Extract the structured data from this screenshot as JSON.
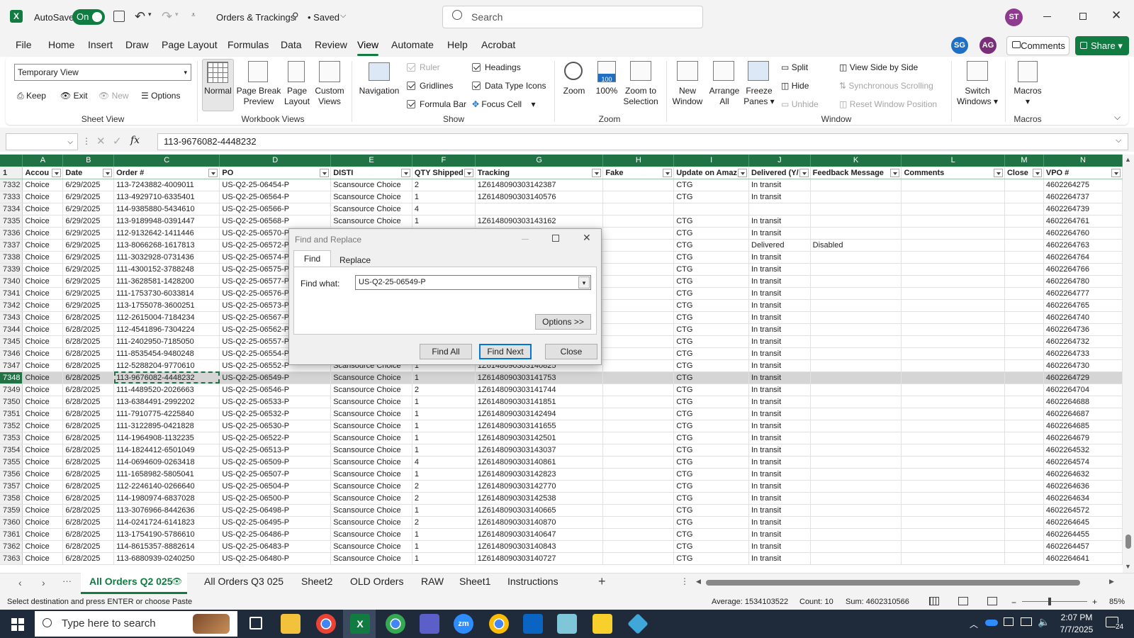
{
  "titlebar": {
    "autosave_label": "AutoSave",
    "autosave_state": "On",
    "doc_title": "Orders & Trackings",
    "saved_status": "• Saved",
    "search_placeholder": "Search",
    "user_initials": "ST"
  },
  "menu": {
    "items": [
      "File",
      "Home",
      "Insert",
      "Draw",
      "Page Layout",
      "Formulas",
      "Data",
      "Review",
      "View",
      "Automate",
      "Help",
      "Acrobat"
    ],
    "active": "View",
    "collab": [
      "SG",
      "AG"
    ],
    "comments_label": "Comments",
    "share_label": "Share"
  },
  "ribbon": {
    "sheet_view": {
      "dropdown_value": "Temporary View",
      "keep": "Keep",
      "exit": "Exit",
      "new": "New",
      "options": "Options",
      "group_label": "Sheet View"
    },
    "workbook_views": {
      "normal": "Normal",
      "page_break": "Page Break Preview",
      "page_layout": "Page Layout",
      "custom": "Custom Views",
      "group_label": "Workbook Views"
    },
    "show": {
      "navigation": "Navigation",
      "ruler": "Ruler",
      "gridlines": "Gridlines",
      "formula_bar": "Formula Bar",
      "headings": "Headings",
      "data_type_icons": "Data Type Icons",
      "focus_cell": "Focus Cell",
      "group_label": "Show"
    },
    "zoom": {
      "zoom": "Zoom",
      "hundred": "100%",
      "zoom_selection": "Zoom to Selection",
      "group_label": "Zoom"
    },
    "window": {
      "new_window": "New Window",
      "arrange_all": "Arrange All",
      "freeze_panes": "Freeze Panes",
      "split": "Split",
      "hide": "Hide",
      "unhide": "Unhide",
      "side_by_side": "View Side by Side",
      "sync_scroll": "Synchronous Scrolling",
      "reset_pos": "Reset Window Position",
      "switch": "Switch Windows",
      "group_label": "Window"
    },
    "macros": {
      "macros": "Macros",
      "group_label": "Macros"
    }
  },
  "formula_bar": {
    "name_box": "",
    "fx": "fx",
    "value": "113-9676082-4448232"
  },
  "grid": {
    "columns": [
      "A",
      "B",
      "C",
      "D",
      "E",
      "F",
      "G",
      "H",
      "I",
      "J",
      "K",
      "L",
      "M",
      "N"
    ],
    "headers": [
      "Accou",
      "Date",
      "Order #",
      "PO",
      "DISTI",
      "QTY Shipped",
      "Tracking",
      "Fake",
      "Update on Amaz",
      "Delivered (Y/",
      "Feedback Message",
      "Comments",
      "Close",
      "VPO #"
    ],
    "header_row_num": "1",
    "rows": [
      [
        "7332",
        "Choice",
        "6/29/2025",
        "113-7243882-4009011",
        "US-Q2-25-06454-P",
        "Scansource Choice",
        "2",
        "1Z6148090303142387",
        "",
        "CTG",
        "In transit",
        "",
        "",
        "",
        "4602264275"
      ],
      [
        "7333",
        "Choice",
        "6/29/2025",
        "113-4929710-6335401",
        "US-Q2-25-06564-P",
        "Scansource Choice",
        "1",
        "1Z6148090303140576",
        "",
        "CTG",
        "In transit",
        "",
        "",
        "",
        "4602264737"
      ],
      [
        "7334",
        "Choice",
        "6/29/2025",
        "114-9385880-5434610",
        "US-Q2-25-06566-P",
        "Scansource Choice",
        "4",
        "",
        "",
        "",
        "",
        "",
        "",
        "",
        "4602264739"
      ],
      [
        "7335",
        "Choice",
        "6/29/2025",
        "113-9189948-0391447",
        "US-Q2-25-06568-P",
        "Scansource Choice",
        "1",
        "1Z6148090303143162",
        "",
        "CTG",
        "In transit",
        "",
        "",
        "",
        "4602264761"
      ],
      [
        "7336",
        "Choice",
        "6/29/2025",
        "112-9132642-1411446",
        "US-Q2-25-06570-P",
        "",
        "",
        "",
        "",
        "CTG",
        "In transit",
        "",
        "",
        "",
        "4602264760"
      ],
      [
        "7337",
        "Choice",
        "6/29/2025",
        "113-8066268-1617813",
        "US-Q2-25-06572-P",
        "",
        "",
        "",
        "",
        "CTG",
        "Delivered",
        "Disabled",
        "",
        "",
        "4602264763"
      ],
      [
        "7338",
        "Choice",
        "6/29/2025",
        "111-3032928-0731436",
        "US-Q2-25-06574-P",
        "",
        "",
        "",
        "",
        "CTG",
        "In transit",
        "",
        "",
        "",
        "4602264764"
      ],
      [
        "7339",
        "Choice",
        "6/29/2025",
        "111-4300152-3788248",
        "US-Q2-25-06575-P",
        "",
        "",
        "",
        "",
        "CTG",
        "In transit",
        "",
        "",
        "",
        "4602264766"
      ],
      [
        "7340",
        "Choice",
        "6/29/2025",
        "111-3628581-1428200",
        "US-Q2-25-06577-P",
        "",
        "",
        "",
        "",
        "CTG",
        "In transit",
        "",
        "",
        "",
        "4602264780"
      ],
      [
        "7341",
        "Choice",
        "6/29/2025",
        "111-1753730-6033814",
        "US-Q2-25-06576-P",
        "",
        "",
        "",
        "",
        "CTG",
        "In transit",
        "",
        "",
        "",
        "4602264777"
      ],
      [
        "7342",
        "Choice",
        "6/29/2025",
        "113-1755078-3600251",
        "US-Q2-25-06573-P",
        "",
        "",
        "",
        "",
        "CTG",
        "In transit",
        "",
        "",
        "",
        "4602264765"
      ],
      [
        "7343",
        "Choice",
        "6/28/2025",
        "112-2615004-7184234",
        "US-Q2-25-06567-P",
        "",
        "",
        "",
        "",
        "CTG",
        "In transit",
        "",
        "",
        "",
        "4602264740"
      ],
      [
        "7344",
        "Choice",
        "6/28/2025",
        "112-4541896-7304224",
        "US-Q2-25-06562-P",
        "",
        "",
        "",
        "",
        "CTG",
        "In transit",
        "",
        "",
        "",
        "4602264736"
      ],
      [
        "7345",
        "Choice",
        "6/28/2025",
        "111-2402950-7185050",
        "US-Q2-25-06557-P",
        "",
        "",
        "",
        "",
        "CTG",
        "In transit",
        "",
        "",
        "",
        "4602264732"
      ],
      [
        "7346",
        "Choice",
        "6/28/2025",
        "111-8535454-9480248",
        "US-Q2-25-06554-P",
        "",
        "",
        "",
        "",
        "CTG",
        "In transit",
        "",
        "",
        "",
        "4602264733"
      ],
      [
        "7347",
        "Choice",
        "6/28/2025",
        "112-5288204-9770610",
        "US-Q2-25-06552-P",
        "Scansource Choice",
        "1",
        "1Z6148090303140825",
        "",
        "CTG",
        "In transit",
        "",
        "",
        "",
        "4602264730"
      ],
      [
        "7348",
        "Choice",
        "6/28/2025",
        "113-9676082-4448232",
        "US-Q2-25-06549-P",
        "Scansource Choice",
        "1",
        "1Z6148090303141753",
        "",
        "CTG",
        "In transit",
        "",
        "",
        "",
        "4602264729"
      ],
      [
        "7349",
        "Choice",
        "6/28/2025",
        "111-4489520-2026663",
        "US-Q2-25-06546-P",
        "Scansource Choice",
        "2",
        "1Z6148090303141744",
        "",
        "CTG",
        "In transit",
        "",
        "",
        "",
        "4602264704"
      ],
      [
        "7350",
        "Choice",
        "6/28/2025",
        "113-6384491-2992202",
        "US-Q2-25-06533-P",
        "Scansource Choice",
        "1",
        "1Z6148090303141851",
        "",
        "CTG",
        "In transit",
        "",
        "",
        "",
        "4602264688"
      ],
      [
        "7351",
        "Choice",
        "6/28/2025",
        "111-7910775-4225840",
        "US-Q2-25-06532-P",
        "Scansource Choice",
        "1",
        "1Z6148090303142494",
        "",
        "CTG",
        "In transit",
        "",
        "",
        "",
        "4602264687"
      ],
      [
        "7352",
        "Choice",
        "6/28/2025",
        "111-3122895-0421828",
        "US-Q2-25-06530-P",
        "Scansource Choice",
        "1",
        "1Z6148090303141655",
        "",
        "CTG",
        "In transit",
        "",
        "",
        "",
        "4602264685"
      ],
      [
        "7353",
        "Choice",
        "6/28/2025",
        "114-1964908-1132235",
        "US-Q2-25-06522-P",
        "Scansource Choice",
        "1",
        "1Z6148090303142501",
        "",
        "CTG",
        "In transit",
        "",
        "",
        "",
        "4602264679"
      ],
      [
        "7354",
        "Choice",
        "6/28/2025",
        "114-1824412-6501049",
        "US-Q2-25-06513-P",
        "Scansource Choice",
        "1",
        "1Z6148090303143037",
        "",
        "CTG",
        "In transit",
        "",
        "",
        "",
        "4602264532"
      ],
      [
        "7355",
        "Choice",
        "6/28/2025",
        "114-0694609-0263418",
        "US-Q2-25-06509-P",
        "Scansource Choice",
        "4",
        "1Z6148090303140861",
        "",
        "CTG",
        "In transit",
        "",
        "",
        "",
        "4602264574"
      ],
      [
        "7356",
        "Choice",
        "6/28/2025",
        "111-1658982-5805041",
        "US-Q2-25-06507-P",
        "Scansource Choice",
        "1",
        "1Z6148090303142823",
        "",
        "CTG",
        "In transit",
        "",
        "",
        "",
        "4602264632"
      ],
      [
        "7357",
        "Choice",
        "6/28/2025",
        "112-2246140-0266640",
        "US-Q2-25-06504-P",
        "Scansource Choice",
        "2",
        "1Z6148090303142770",
        "",
        "CTG",
        "In transit",
        "",
        "",
        "",
        "4602264636"
      ],
      [
        "7358",
        "Choice",
        "6/28/2025",
        "114-1980974-6837028",
        "US-Q2-25-06500-P",
        "Scansource Choice",
        "2",
        "1Z6148090303142538",
        "",
        "CTG",
        "In transit",
        "",
        "",
        "",
        "4602264634"
      ],
      [
        "7359",
        "Choice",
        "6/28/2025",
        "113-3076966-8442636",
        "US-Q2-25-06498-P",
        "Scansource Choice",
        "1",
        "1Z6148090303140665",
        "",
        "CTG",
        "In transit",
        "",
        "",
        "",
        "4602264572"
      ],
      [
        "7360",
        "Choice",
        "6/28/2025",
        "114-0241724-6141823",
        "US-Q2-25-06495-P",
        "Scansource Choice",
        "2",
        "1Z6148090303140870",
        "",
        "CTG",
        "In transit",
        "",
        "",
        "",
        "4602264645"
      ],
      [
        "7361",
        "Choice",
        "6/28/2025",
        "113-1754190-5786610",
        "US-Q2-25-06486-P",
        "Scansource Choice",
        "1",
        "1Z6148090303140647",
        "",
        "CTG",
        "In transit",
        "",
        "",
        "",
        "4602264455"
      ],
      [
        "7362",
        "Choice",
        "6/28/2025",
        "114-8615357-8882614",
        "US-Q2-25-06483-P",
        "Scansource Choice",
        "1",
        "1Z6148090303140843",
        "",
        "CTG",
        "In transit",
        "",
        "",
        "",
        "4602264457"
      ],
      [
        "7363",
        "Choice",
        "6/28/2025",
        "113-6880939-0240250",
        "US-Q2-25-06480-P",
        "Scansource Choice",
        "1",
        "1Z6148090303140727",
        "",
        "CTG",
        "In transit",
        "",
        "",
        "",
        "4602264641"
      ]
    ]
  },
  "dialog": {
    "title": "Find and Replace",
    "tab_find": "Find",
    "tab_replace": "Replace",
    "find_label": "Find what:",
    "find_value": "US-Q2-25-06549-P",
    "options_btn": "Options >>",
    "find_all": "Find All",
    "find_next": "Find Next",
    "close": "Close"
  },
  "sheet_tabs": [
    "All Orders Q2 025",
    "All Orders Q3 025",
    "Sheet2",
    "OLD Orders",
    "RAW",
    "Sheet1",
    "Instructions"
  ],
  "active_sheet": "All Orders Q2 025",
  "status": {
    "message": "Select destination and press ENTER or choose Paste",
    "average": "Average: 1534103522",
    "count": "Count: 10",
    "sum": "Sum: 4602310566",
    "zoom": "85%"
  },
  "taskbar": {
    "search_placeholder": "Type here to search",
    "time": "2:07 PM",
    "date": "7/7/2025",
    "notif_count": "24"
  }
}
